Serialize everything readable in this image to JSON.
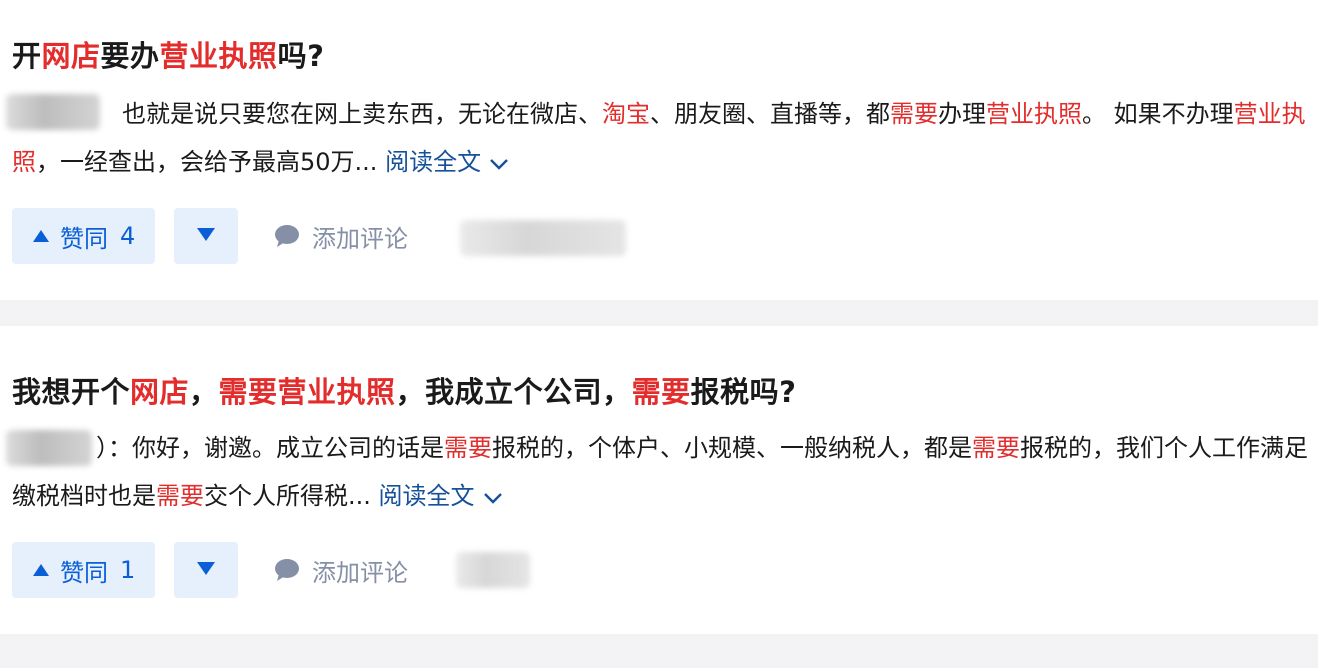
{
  "answers": [
    {
      "title_parts": [
        {
          "text": "开",
          "hl": false
        },
        {
          "text": "网店",
          "hl": true
        },
        {
          "text": "要办",
          "hl": false
        },
        {
          "text": "营业执照",
          "hl": true
        },
        {
          "text": "吗?",
          "hl": false
        }
      ],
      "excerpt_parts": [
        {
          "text": "也就是说只要您在网上卖东西，无论在微店、",
          "hl": false
        },
        {
          "text": "淘宝",
          "hl": true
        },
        {
          "text": "、朋友圈、直播等，都",
          "hl": false
        },
        {
          "text": "需要",
          "hl": true
        },
        {
          "text": "办理",
          "hl": false
        },
        {
          "text": "营业执照",
          "hl": true
        },
        {
          "text": "。 如果不办理",
          "hl": false
        },
        {
          "text": "营业执照",
          "hl": true
        },
        {
          "text": "，一经查出，会给予最高50万...",
          "hl": false
        }
      ],
      "read_more": "阅读全文",
      "vote_label": "赞同",
      "vote_count": "4",
      "comment_label": "添加评论"
    },
    {
      "title_parts": [
        {
          "text": "我想开个",
          "hl": false
        },
        {
          "text": "网店",
          "hl": true
        },
        {
          "text": "，",
          "hl": false
        },
        {
          "text": "需要营业执照",
          "hl": true
        },
        {
          "text": "，我成立个公司，",
          "hl": false
        },
        {
          "text": "需要",
          "hl": true
        },
        {
          "text": "报税吗?",
          "hl": false
        }
      ],
      "excerpt_parts": [
        {
          "text": "）：你好，谢邀。成立公司的话是",
          "hl": false
        },
        {
          "text": "需要",
          "hl": true
        },
        {
          "text": "报税的，个体户、小规模、一般纳税人，都是",
          "hl": false
        },
        {
          "text": "需要",
          "hl": true
        },
        {
          "text": "报税的，我们个人工作满足缴税档时也是",
          "hl": false
        },
        {
          "text": "需要",
          "hl": true
        },
        {
          "text": "交个人所得税...",
          "hl": false
        }
      ],
      "read_more": "阅读全文",
      "vote_label": "赞同",
      "vote_count": "1",
      "comment_label": "添加评论"
    }
  ],
  "colors": {
    "highlight": "#e32d2d",
    "link": "#175199",
    "vote_bg": "#e6effc",
    "vote_text": "#0a5fd6",
    "muted": "#8590a6"
  }
}
